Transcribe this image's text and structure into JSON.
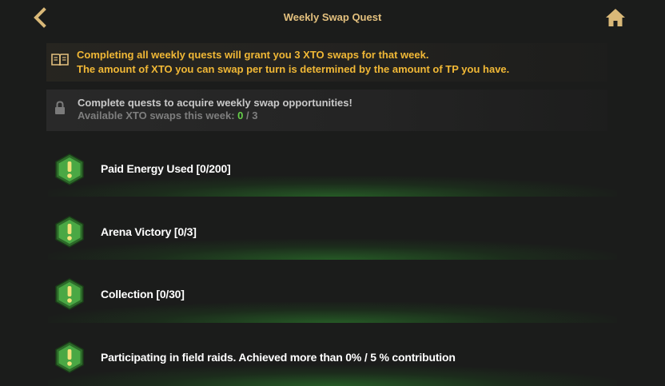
{
  "header": {
    "title": "Weekly Swap Quest",
    "back_icon": "chevron-left-icon",
    "home_icon": "home-icon"
  },
  "info": {
    "icon": "book-icon",
    "line1": "Completing all weekly quests will grant you 3 XTO swaps for that week.",
    "line2": "The amount of XTO you can swap per turn is determined by the amount of TP you have."
  },
  "lock": {
    "icon": "lock-icon",
    "title": "Complete quests to acquire weekly swap opportunities!",
    "subtitle_prefix": "Available XTO swaps this week: ",
    "current": "0",
    "separator": " / ",
    "total": "3"
  },
  "quests": [
    {
      "label": "Paid Energy Used [0/200]",
      "icon": "exclamation-hex-icon"
    },
    {
      "label": "Arena Victory [0/3]",
      "icon": "exclamation-hex-icon"
    },
    {
      "label": "Collection [0/30]",
      "icon": "exclamation-hex-icon"
    },
    {
      "label": "Participating in field raids. Achieved more than 0% / 5 % contribution",
      "icon": "exclamation-hex-icon"
    }
  ],
  "colors": {
    "accent_gold": "#e3c07e",
    "info_text": "#f1b836",
    "count_green": "#66d049",
    "hex_green": "#3f9a3a"
  }
}
